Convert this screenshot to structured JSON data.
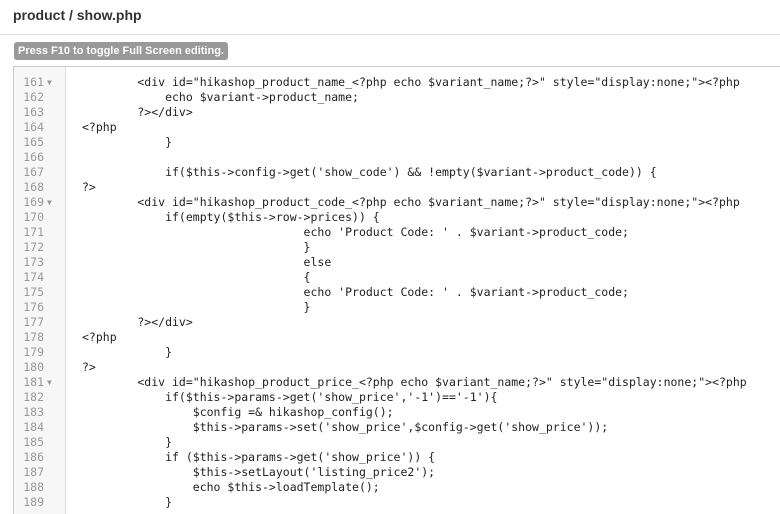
{
  "header": {
    "title": "product / show.php",
    "hint": "Press F10 to toggle Full Screen editing."
  },
  "editor": {
    "partial_top": "",
    "lines": [
      {
        "no": "161",
        "fold": true,
        "text": "        <div id=\"hikashop_product_name_<?php echo $variant_name;?>\" style=\"display:none;\"><?php"
      },
      {
        "no": "162",
        "fold": false,
        "text": "            echo $variant->product_name;"
      },
      {
        "no": "163",
        "fold": false,
        "text": "        ?></div>"
      },
      {
        "no": "164",
        "fold": false,
        "text": "<?php"
      },
      {
        "no": "165",
        "fold": false,
        "text": "            }"
      },
      {
        "no": "166",
        "fold": false,
        "text": ""
      },
      {
        "no": "167",
        "fold": false,
        "text": "            if($this->config->get('show_code') && !empty($variant->product_code)) {"
      },
      {
        "no": "168",
        "fold": false,
        "text": "?>"
      },
      {
        "no": "169",
        "fold": true,
        "text": "        <div id=\"hikashop_product_code_<?php echo $variant_name;?>\" style=\"display:none;\"><?php"
      },
      {
        "no": "170",
        "fold": false,
        "text": "            if(empty($this->row->prices)) {"
      },
      {
        "no": "171",
        "fold": false,
        "text": "                                echo 'Product Code: ' . $variant->product_code;"
      },
      {
        "no": "172",
        "fold": false,
        "text": "                                }"
      },
      {
        "no": "173",
        "fold": false,
        "text": "                                else"
      },
      {
        "no": "174",
        "fold": false,
        "text": "                                {"
      },
      {
        "no": "175",
        "fold": false,
        "text": "                                echo 'Product Code: ' . $variant->product_code;"
      },
      {
        "no": "176",
        "fold": false,
        "text": "                                }"
      },
      {
        "no": "177",
        "fold": false,
        "text": "        ?></div>"
      },
      {
        "no": "178",
        "fold": false,
        "text": "<?php"
      },
      {
        "no": "179",
        "fold": false,
        "text": "            }"
      },
      {
        "no": "180",
        "fold": false,
        "text": "?>"
      },
      {
        "no": "181",
        "fold": true,
        "text": "        <div id=\"hikashop_product_price_<?php echo $variant_name;?>\" style=\"display:none;\"><?php"
      },
      {
        "no": "182",
        "fold": false,
        "text": "            if($this->params->get('show_price','-1')=='-1'){"
      },
      {
        "no": "183",
        "fold": false,
        "text": "                $config =& hikashop_config();"
      },
      {
        "no": "184",
        "fold": false,
        "text": "                $this->params->set('show_price',$config->get('show_price'));"
      },
      {
        "no": "185",
        "fold": false,
        "text": "            }"
      },
      {
        "no": "186",
        "fold": false,
        "text": "            if ($this->params->get('show_price')) {"
      },
      {
        "no": "187",
        "fold": false,
        "text": "                $this->setLayout('listing_price2');"
      },
      {
        "no": "188",
        "fold": false,
        "text": "                echo $this->loadTemplate();"
      },
      {
        "no": "189",
        "fold": false,
        "text": "            }"
      }
    ]
  }
}
